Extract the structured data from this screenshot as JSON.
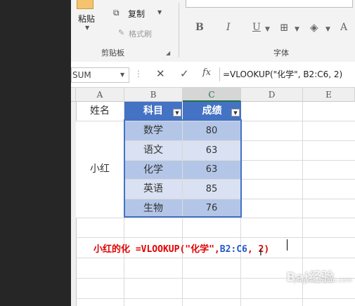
{
  "ribbon": {
    "paste_label": "粘贴",
    "copy_label": "复制",
    "format_painter_label": "格式刷",
    "clipboard_group": "剪贴板",
    "font_group": "字体",
    "font_buttons": [
      "B",
      "I",
      "U",
      "A"
    ]
  },
  "formula_bar": {
    "name_box": "SUM",
    "content": "=VLOOKUP(\"化学\", B2:C6, 2)"
  },
  "columns": [
    "A",
    "B",
    "C",
    "D",
    "E"
  ],
  "table": {
    "a_header": "姓名",
    "headers": [
      "科目",
      "成绩"
    ],
    "name": "小红",
    "rows": [
      {
        "subject": "数学",
        "score": "80"
      },
      {
        "subject": "语文",
        "score": "63"
      },
      {
        "subject": "化学",
        "score": "63"
      },
      {
        "subject": "英语",
        "score": "85"
      },
      {
        "subject": "生物",
        "score": "76"
      }
    ]
  },
  "editing": {
    "prefix": "小红的化 =VLOOKUP(\"化学\",",
    "ref": "B2:C6",
    "suffix": ", 2)"
  },
  "watermark": {
    "main": "Bai经验",
    "sub": "jingyan.baidu.com"
  },
  "colors": {
    "accent": "#217346",
    "table_header": "#4472c4",
    "band": "#b4c6e7",
    "formula_red": "#e00000",
    "ref_blue": "#2459c8"
  }
}
